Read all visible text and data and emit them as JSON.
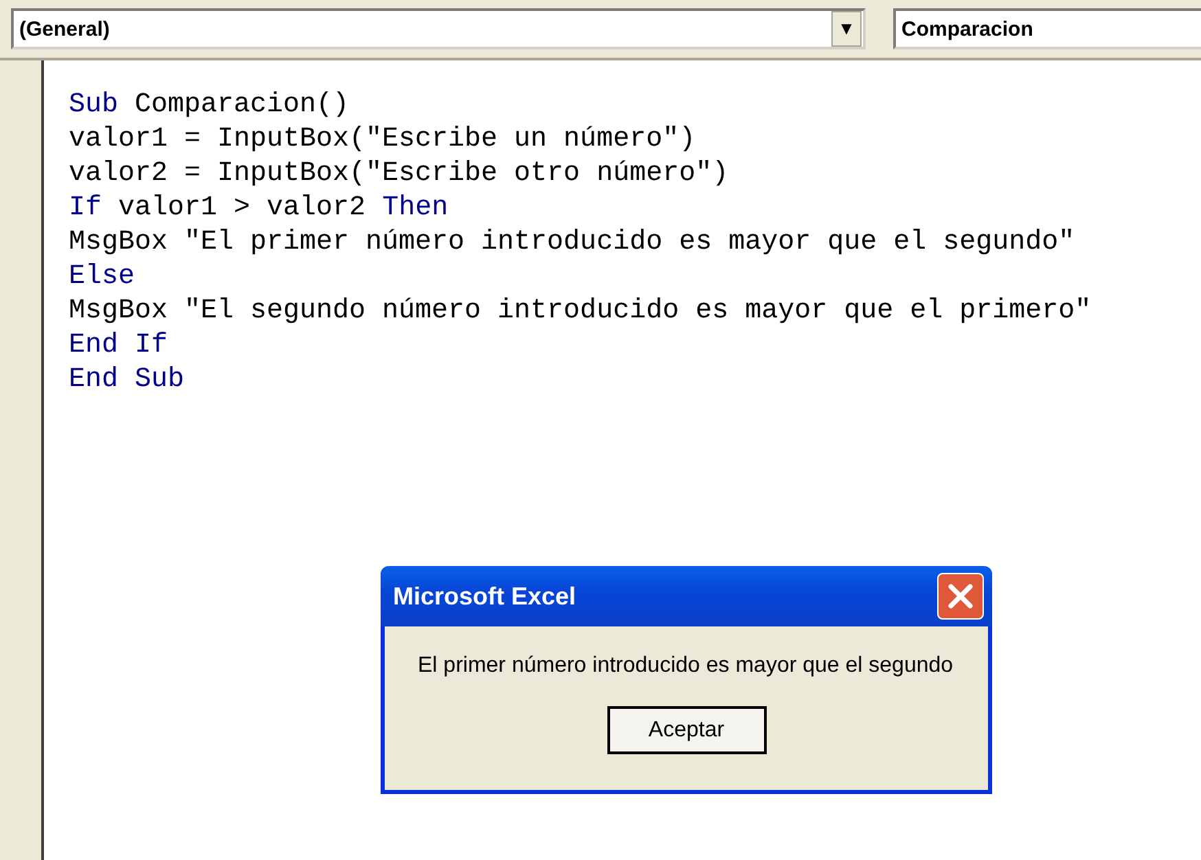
{
  "object_combo": {
    "value": "(General)",
    "arrow": "▼"
  },
  "procedure_combo": {
    "value": "Comparacion"
  },
  "code_lines": [
    [
      {
        "text": "Sub",
        "kind": "keyword"
      },
      {
        "text": " Comparacion()",
        "kind": "plain"
      }
    ],
    [
      {
        "text": "valor1 = InputBox(\"Escribe un número\")",
        "kind": "plain"
      }
    ],
    [
      {
        "text": "valor2 = InputBox(\"Escribe otro número\")",
        "kind": "plain"
      }
    ],
    [
      {
        "text": "If",
        "kind": "keyword"
      },
      {
        "text": " valor1 > valor2 ",
        "kind": "plain"
      },
      {
        "text": "Then",
        "kind": "keyword"
      }
    ],
    [
      {
        "text": "MsgBox \"El primer número introducido es mayor que el segundo\"",
        "kind": "plain"
      }
    ],
    [
      {
        "text": "Else",
        "kind": "keyword"
      }
    ],
    [
      {
        "text": "MsgBox \"El segundo número introducido es mayor que el primero\"",
        "kind": "plain"
      }
    ],
    [
      {
        "text": "End If",
        "kind": "keyword"
      }
    ],
    [
      {
        "text": "End Sub",
        "kind": "keyword"
      }
    ]
  ],
  "dialog": {
    "title": "Microsoft Excel",
    "message": "El primer número introducido es mayor que el segundo",
    "button": "Aceptar"
  }
}
